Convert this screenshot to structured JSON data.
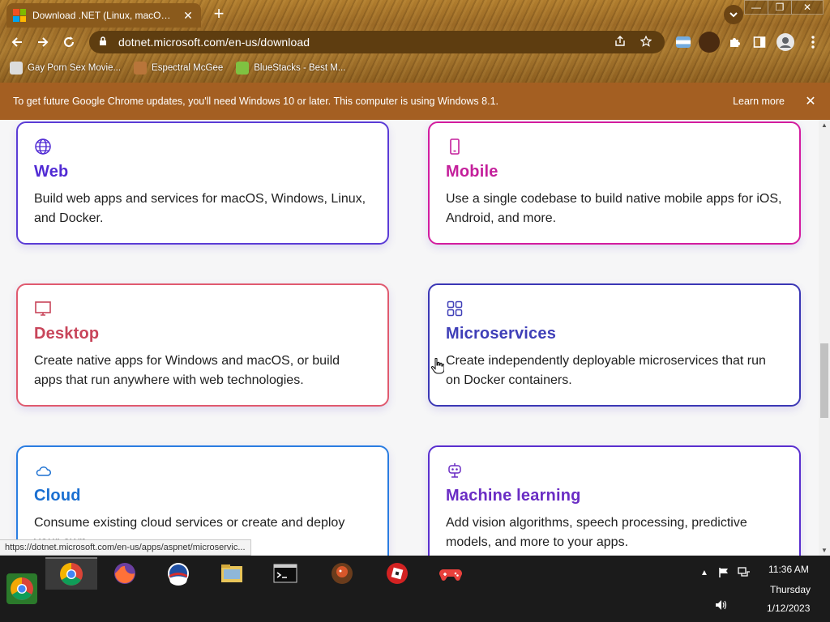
{
  "browser": {
    "tab_title": "Download .NET (Linux, macOS, and Windows)",
    "tab_close": "✕",
    "new_tab": "+",
    "url": "dotnet.microsoft.com/en-us/download",
    "window_controls": [
      "—",
      "❐",
      "✕"
    ],
    "bookmarks": [
      {
        "label": "Gay Porn Sex Movie...",
        "icon": "bookmark-favicon",
        "color": "#dcdcdc"
      },
      {
        "label": "Espectral McGee",
        "icon": "bookmark-favicon",
        "color": "#b8753a"
      },
      {
        "label": "BlueStacks - Best M...",
        "icon": "bluestacks-icon",
        "color": "#7fc241"
      }
    ]
  },
  "infobar": {
    "message": "To get future Google Chrome updates, you'll need Windows 10 or later. This computer is using Windows 8.1.",
    "learn_more": "Learn more",
    "close": "✕"
  },
  "cards": [
    {
      "id": "web",
      "title": "Web",
      "desc": "Build web apps and services for macOS, Windows, Linux, and Docker.",
      "color": "#512bd4",
      "border": "#5b3cd6",
      "icon": "globe-icon"
    },
    {
      "id": "mobile",
      "title": "Mobile",
      "desc": "Use a single codebase to build native mobile apps for iOS, Android, and more.",
      "color": "#c41f9b",
      "border": "#d31c9f",
      "icon": "phone-icon"
    },
    {
      "id": "desktop",
      "title": "Desktop",
      "desc": "Create native apps for Windows and macOS, or build apps that run anywhere with web technologies.",
      "color": "#c8455a",
      "border": "#e05a6f",
      "icon": "monitor-icon"
    },
    {
      "id": "microservices",
      "title": "Microservices",
      "desc": "Create independently deployable microservices that run on Docker containers.",
      "color": "#3f3fb8",
      "border": "#3b37b5",
      "icon": "grid-icon"
    },
    {
      "id": "cloud",
      "title": "Cloud",
      "desc": "Consume existing cloud services or create and deploy your own.",
      "color": "#1a6fd1",
      "border": "#2a7de1",
      "icon": "cloud-icon"
    },
    {
      "id": "ml",
      "title": "Machine learning",
      "desc": "Add vision algorithms, speech processing, predictive models, and more to your apps.",
      "color": "#6a2cc4",
      "border": "#5a2fcf",
      "icon": "robot-icon"
    }
  ],
  "status_url": "https://dotnet.microsoft.com/en-us/apps/aspnet/microservic...",
  "taskbar": {
    "apps": [
      "chrome-icon",
      "firefox-icon",
      "obama-logo-icon",
      "file-explorer-icon",
      "cmd-icon",
      "bird-app-icon",
      "roblox-icon",
      "gamepad-icon"
    ],
    "time": "11:36 AM",
    "day": "Thursday",
    "date": "1/12/2023"
  }
}
